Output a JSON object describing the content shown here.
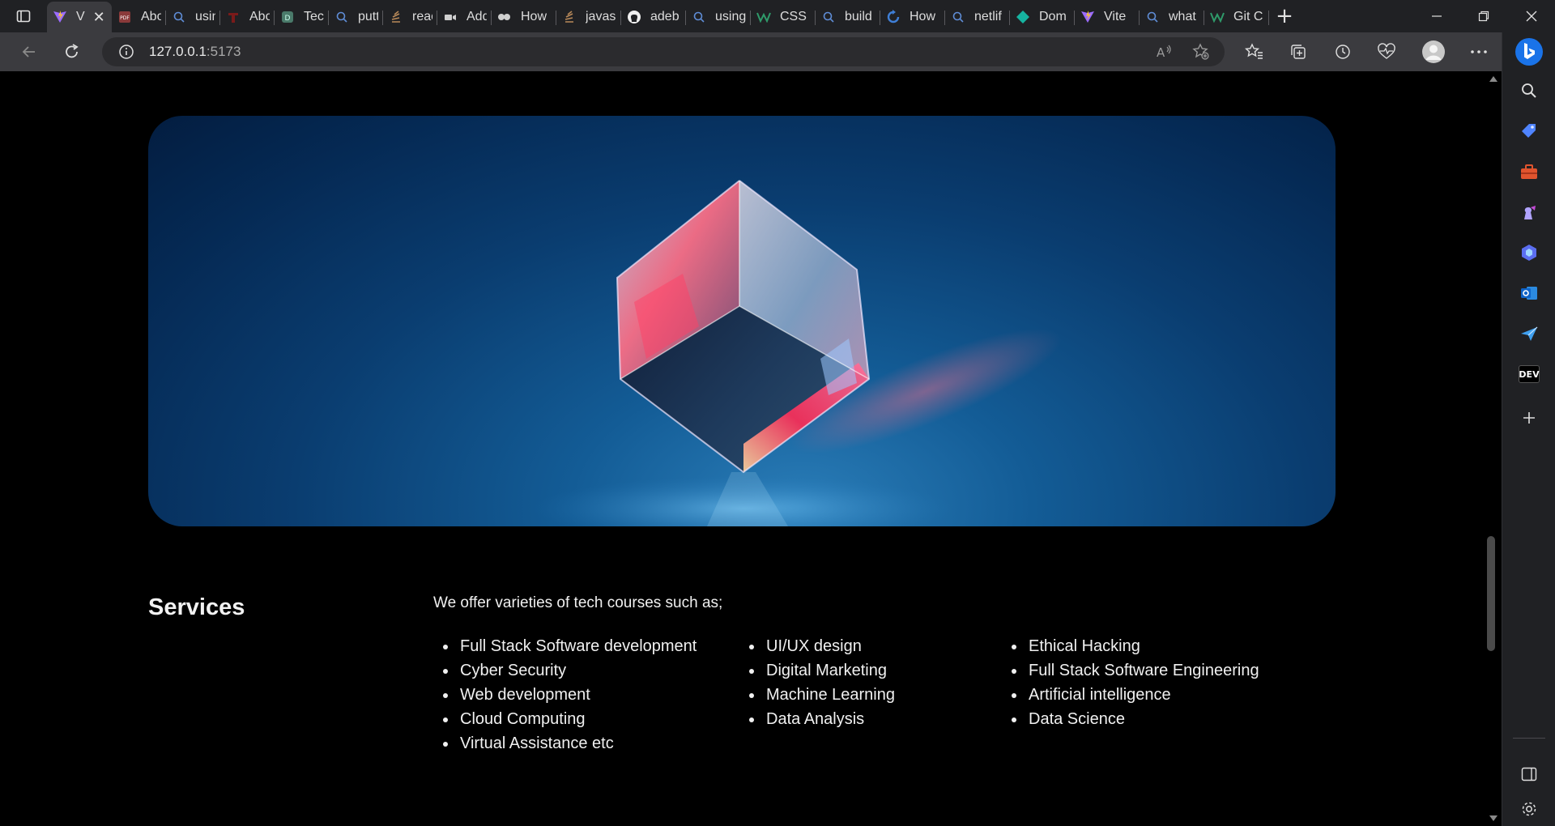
{
  "browser": {
    "tabs": [
      {
        "title": "V",
        "favicon": "vite-logo-icon",
        "active": true
      },
      {
        "title": "Abou",
        "favicon": "pdf-icon"
      },
      {
        "title": "using",
        "favicon": "search-icon"
      },
      {
        "title": "Abou",
        "favicon": "red-t-icon"
      },
      {
        "title": "Tech",
        "favicon": "green-square-icon"
      },
      {
        "title": "puttir",
        "favicon": "search-icon"
      },
      {
        "title": "react",
        "favicon": "stack-icon"
      },
      {
        "title": "Add",
        "favicon": "video-icon"
      },
      {
        "title": "How",
        "favicon": "camera-icon"
      },
      {
        "title": "javas",
        "favicon": "stack-icon"
      },
      {
        "title": "adeb",
        "favicon": "github-icon"
      },
      {
        "title": "using",
        "favicon": "search-icon"
      },
      {
        "title": "CSS",
        "favicon": "w-icon"
      },
      {
        "title": "build",
        "favicon": "search-icon"
      },
      {
        "title": "How",
        "favicon": "refresh-logo-icon"
      },
      {
        "title": "netlif",
        "favicon": "search-icon"
      },
      {
        "title": "Dom",
        "favicon": "teal-diamond-icon"
      },
      {
        "title": "Vite",
        "favicon": "vite-logo-icon"
      },
      {
        "title": "what",
        "favicon": "search-icon"
      },
      {
        "title": "Git C",
        "favicon": "w-icon"
      }
    ],
    "url_host": "127.0.0.1",
    "url_port": ":5173",
    "sidebar_dev_label": "DEV"
  },
  "page": {
    "services_title": "Services",
    "services_intro": "We offer varieties of tech courses such as;",
    "columns": [
      [
        "Full Stack Software development",
        "Cyber Security",
        "Web development",
        "Cloud Computing",
        "Virtual Assistance etc"
      ],
      [
        "UI/UX design",
        "Digital Marketing",
        "Machine Learning",
        "Data Analysis"
      ],
      [
        "Ethical Hacking",
        "Full Stack Software Engineering",
        "Artificial intelligence",
        "Data Science"
      ]
    ]
  },
  "colors": {
    "tab_strip": "#202124",
    "toolbar": "#3b3b3f",
    "omnibox": "#2b2b2e",
    "page_bg": "#000000",
    "hero_blue": "#0a3d70",
    "bing_blue": "#1a73e8"
  }
}
